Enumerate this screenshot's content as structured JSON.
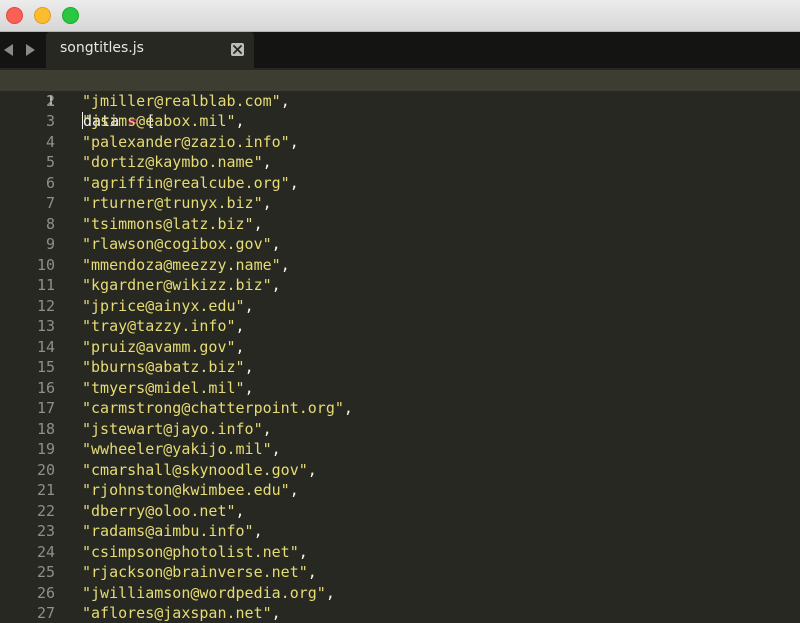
{
  "window": {
    "controls": [
      "close",
      "minimize",
      "zoom"
    ]
  },
  "tabbar": {
    "back_icon": "chevron-left-icon",
    "forward_icon": "chevron-right-icon"
  },
  "tab": {
    "title": "songtitles.js",
    "close_icon": "close-icon"
  },
  "editor": {
    "first_line": {
      "number": "1",
      "ident": "data",
      "op": " = ",
      "bracket": "["
    },
    "lines": [
      {
        "number": "2",
        "text": "\"jmiller@realblab.com\""
      },
      {
        "number": "3",
        "text": "\"jsims@eabox.mil\""
      },
      {
        "number": "4",
        "text": "\"palexander@zazio.info\""
      },
      {
        "number": "5",
        "text": "\"dortiz@kaymbo.name\""
      },
      {
        "number": "6",
        "text": "\"agriffin@realcube.org\""
      },
      {
        "number": "7",
        "text": "\"rturner@trunyx.biz\""
      },
      {
        "number": "8",
        "text": "\"tsimmons@latz.biz\""
      },
      {
        "number": "9",
        "text": "\"rlawson@cogibox.gov\""
      },
      {
        "number": "10",
        "text": "\"mmendoza@meezzy.name\""
      },
      {
        "number": "11",
        "text": "\"kgardner@wikizz.biz\""
      },
      {
        "number": "12",
        "text": "\"jprice@ainyx.edu\""
      },
      {
        "number": "13",
        "text": "\"tray@tazzy.info\""
      },
      {
        "number": "14",
        "text": "\"pruiz@avamm.gov\""
      },
      {
        "number": "15",
        "text": "\"bburns@abatz.biz\""
      },
      {
        "number": "16",
        "text": "\"tmyers@midel.mil\""
      },
      {
        "number": "17",
        "text": "\"carmstrong@chatterpoint.org\""
      },
      {
        "number": "18",
        "text": "\"jstewart@jayo.info\""
      },
      {
        "number": "19",
        "text": "\"wwheeler@yakijo.mil\""
      },
      {
        "number": "20",
        "text": "\"cmarshall@skynoodle.gov\""
      },
      {
        "number": "21",
        "text": "\"rjohnston@kwimbee.edu\""
      },
      {
        "number": "22",
        "text": "\"dberry@oloo.net\""
      },
      {
        "number": "23",
        "text": "\"radams@aimbu.info\""
      },
      {
        "number": "24",
        "text": "\"csimpson@photolist.net\""
      },
      {
        "number": "25",
        "text": "\"rjackson@brainverse.net\""
      },
      {
        "number": "26",
        "text": "\"jwilliamson@wordpedia.org\""
      },
      {
        "number": "27",
        "text": "\"aflores@jaxspan.net\""
      }
    ],
    "separator": ","
  },
  "theme": {
    "background": "#272822",
    "string": "#e6db74",
    "operator": "#f92672",
    "text": "#f8f8f2",
    "line_number": "#8f908a"
  }
}
